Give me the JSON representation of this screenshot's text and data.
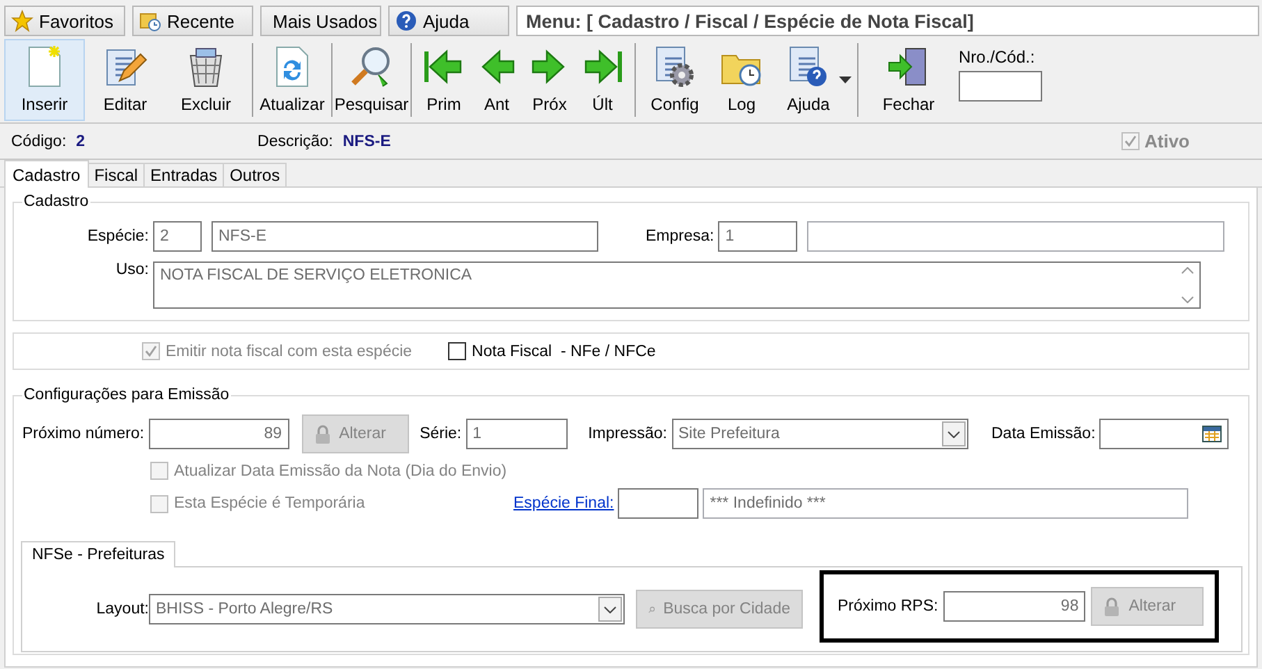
{
  "top_bar": {
    "buttons": [
      {
        "label": "Favoritos"
      },
      {
        "label": "Recente"
      },
      {
        "label": "Mais Usados"
      },
      {
        "label": "Ajuda"
      }
    ],
    "menu_path": "Menu: [ Cadastro / Fiscal / Espécie de Nota Fiscal]"
  },
  "toolbar": {
    "groups": [
      {
        "items": [
          {
            "label": "Inserir",
            "selected": true,
            "menu": false
          },
          {
            "label": "Editar",
            "selected": false,
            "menu": false
          },
          {
            "label": "Excluir",
            "selected": false,
            "menu": false
          }
        ]
      },
      {
        "items": [
          {
            "label": "Atualizar",
            "selected": false,
            "menu": false
          }
        ]
      },
      {
        "items": [
          {
            "label": "Pesquisar",
            "selected": false,
            "menu": false
          }
        ]
      },
      {
        "items": [
          {
            "label": "Prim",
            "selected": false,
            "menu": false
          },
          {
            "label": "Ant",
            "selected": false,
            "menu": false
          },
          {
            "label": "Próx",
            "selected": false,
            "menu": false
          },
          {
            "label": "Últ",
            "selected": false,
            "menu": false
          }
        ]
      },
      {
        "items": [
          {
            "label": "Config",
            "selected": false,
            "menu": false
          },
          {
            "label": "Log",
            "selected": false,
            "menu": false
          },
          {
            "label": "Ajuda",
            "selected": false,
            "menu": true
          }
        ]
      },
      {
        "items": [
          {
            "label": "Fechar",
            "selected": false,
            "menu": false
          }
        ]
      }
    ],
    "lookup_label": "Nro./Cód.:"
  },
  "info": {
    "code_label": "Código:",
    "code": "2",
    "description_label": "Descrição:",
    "description": "NFS-E",
    "active": {
      "label": "Ativo",
      "checked": true,
      "disabled": true
    }
  },
  "tabs": [
    {
      "label": "Cadastro",
      "selected": true
    },
    {
      "label": "Fiscal",
      "selected": false
    },
    {
      "label": "Entradas",
      "selected": false
    },
    {
      "label": "Outros",
      "selected": false
    }
  ],
  "cadastro": {
    "title": "Cadastro",
    "especie_label": "Espécie:",
    "especie_code": "2",
    "especie_name": "NFS-E",
    "empresa_label": "Empresa:",
    "empresa_code": "1",
    "uso_label": "Uso:",
    "uso": "NOTA FISCAL DE SERVIÇO ELETRONICA"
  },
  "options": [
    {
      "label": "Emitir nota fiscal com esta espécie",
      "checked": true,
      "disabled": true
    },
    {
      "label": "Nota Fiscal  - NFe / NFCe",
      "checked": false,
      "disabled": false
    }
  ],
  "emissao": {
    "title": "Configurações para Emissão",
    "next_number_label": "Próximo número:",
    "next_number": "89",
    "change_button": {
      "label": "Alterar",
      "disabled": true
    },
    "serie_label": "Série:",
    "serie": "1",
    "impressao_label": "Impressão:",
    "impressao": "Site Prefeitura",
    "data_label": "Data Emissão:",
    "options": [
      {
        "label": "Atualizar Data Emissão da Nota (Dia do Envio)",
        "checked": false,
        "disabled": true
      },
      {
        "label": "Esta Espécie é Temporária",
        "checked": false,
        "disabled": true
      }
    ],
    "especie_final_link": "Espécie Final:",
    "especie_final_name": "*** Indefinido ***"
  },
  "nfse": {
    "tab": {
      "label": "NFSe - Prefeituras",
      "selected": true
    },
    "layout_label": "Layout:",
    "layout": "BHISS - Porto Alegre/RS",
    "search_button": {
      "label": "Busca por Cidade",
      "disabled": true
    },
    "rps_label": "Próximo RPS:",
    "rps": "98",
    "rps_button": {
      "label": "Alterar",
      "disabled": true
    }
  }
}
